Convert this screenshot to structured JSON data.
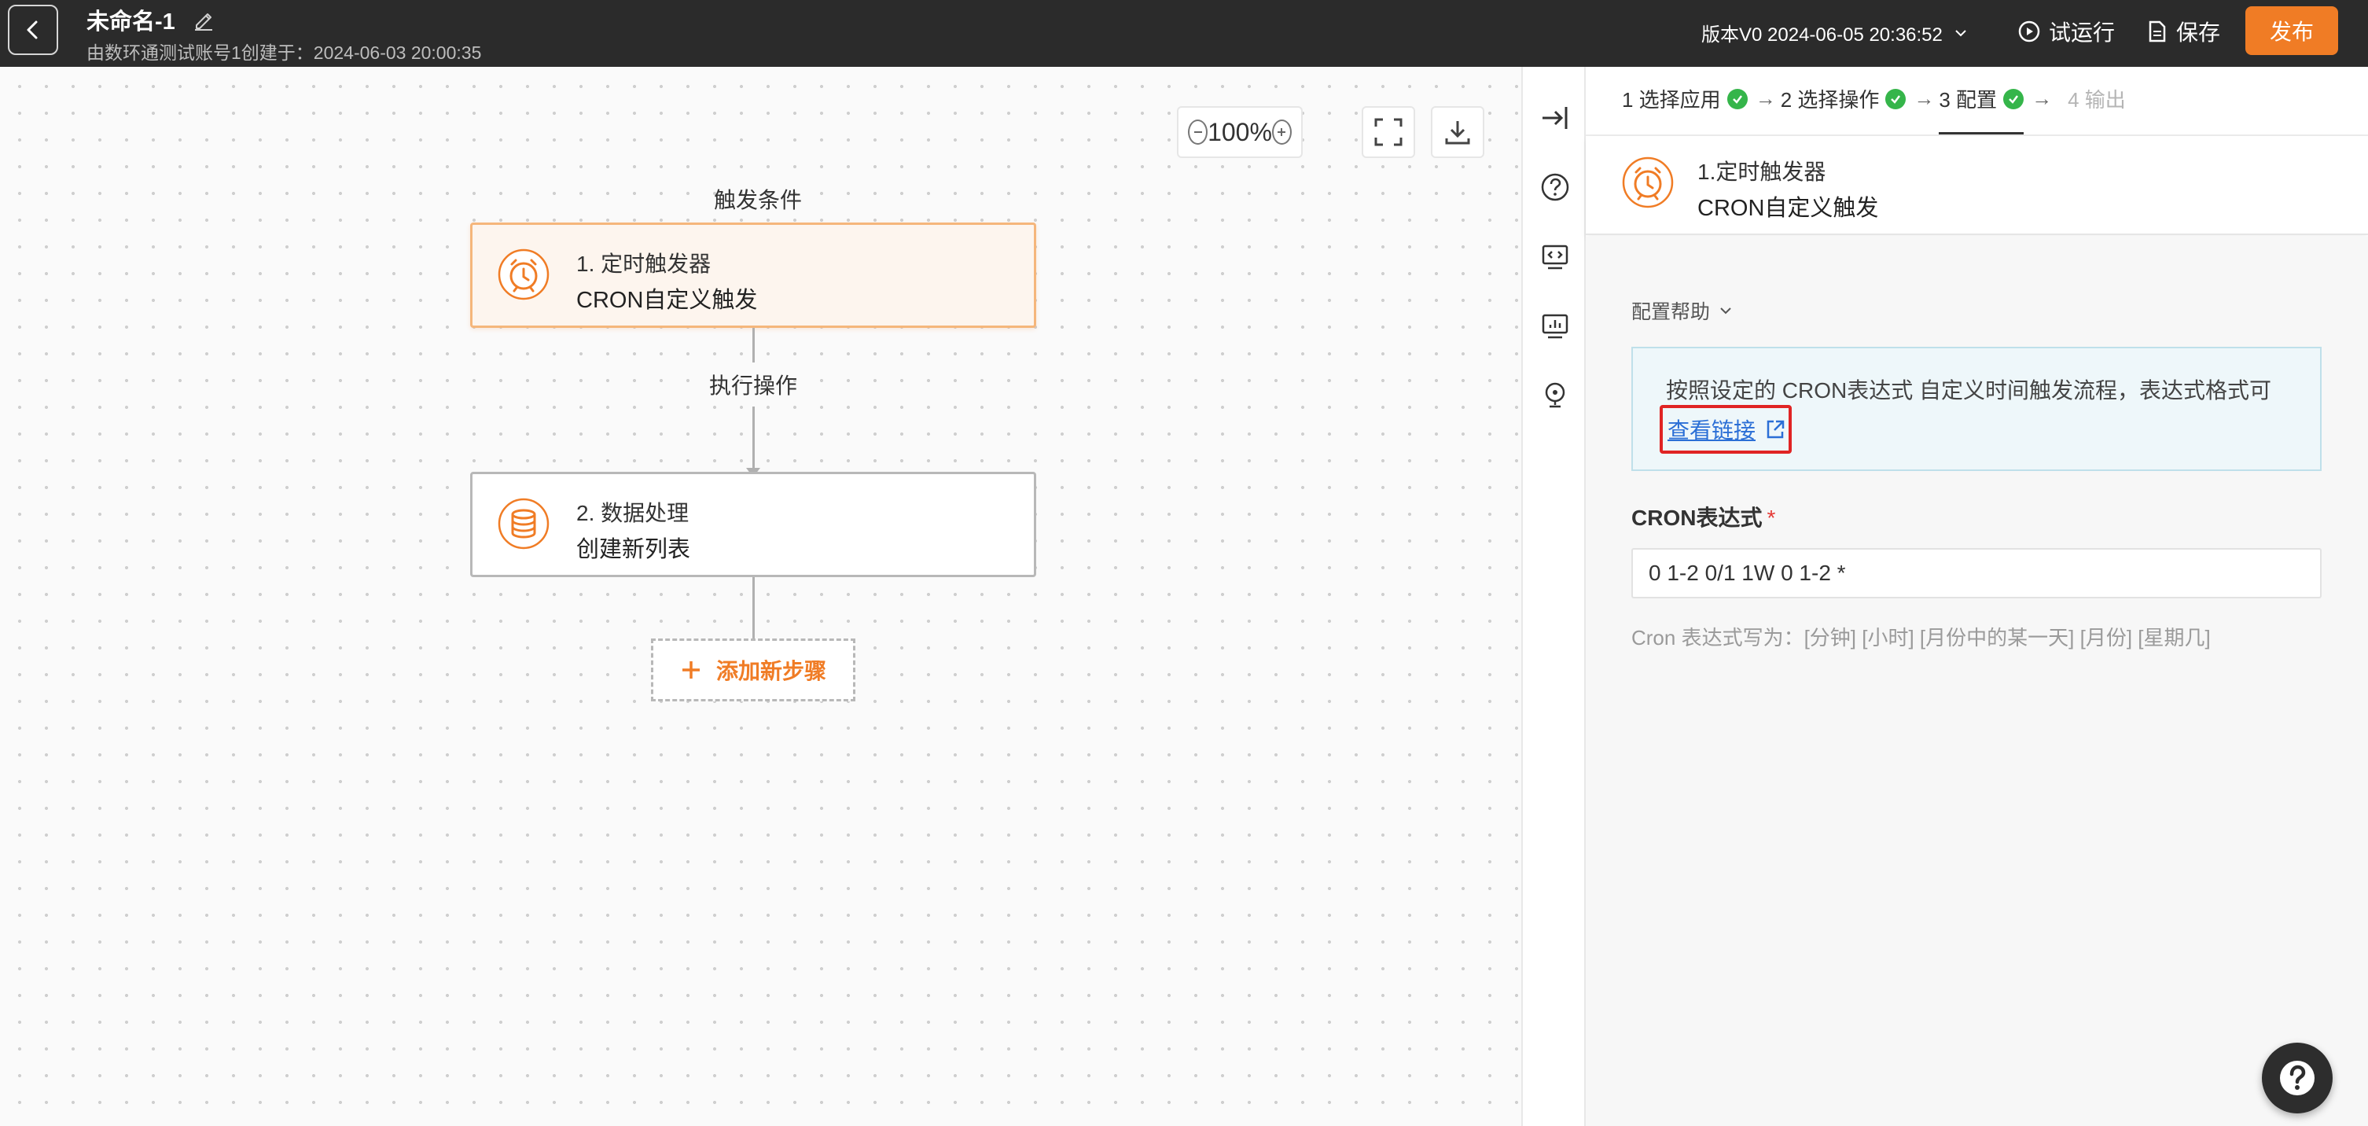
{
  "header": {
    "title": "未命名-1",
    "subtitle": "由数环通测试账号1创建于：2024-06-03 20:00:35",
    "version": "版本V0 2024-06-05 20:36:52",
    "test_run": "试运行",
    "save": "保存",
    "publish": "发布"
  },
  "colors": {
    "accent": "#f07c25",
    "topbar": "#2b2b2b",
    "success": "#35b54a",
    "highlight": "#e02424",
    "link": "#2b6fd6"
  },
  "canvas": {
    "zoom": "100%",
    "trigger_label": "触发条件",
    "action_label": "执行操作",
    "nodes": [
      {
        "title": "1. 定时触发器",
        "subtitle": "CRON自定义触发",
        "icon": "alarm-clock-icon"
      },
      {
        "title": "2. 数据处理",
        "subtitle": "创建新列表",
        "icon": "database-icon"
      }
    ],
    "add_step": "添加新步骤"
  },
  "side_icons": [
    "collapse-panel-icon",
    "help-icon",
    "code-icon",
    "monitor-icon",
    "lightbulb-icon"
  ],
  "panel": {
    "steps": [
      {
        "label": "1 选择应用",
        "done": true
      },
      {
        "label": "2 选择操作",
        "done": true
      },
      {
        "label": "3 配置",
        "done": true,
        "active": true
      },
      {
        "label": "4 输出",
        "done": false
      }
    ],
    "app_title": "1.定时触发器",
    "app_subtitle": "CRON自定义触发",
    "help_toggle": "配置帮助",
    "help_text": "按照设定的 CRON表达式 自定义时间触发流程，表达式格式可",
    "help_link": "查看链接",
    "cron_label": "CRON表达式",
    "cron_required": "*",
    "cron_value": "0 1-2 0/1 1W 0 1-2 *",
    "cron_hint": "Cron 表达式写为：[分钟] [小时] [月份中的某一天] [月份] [星期几]"
  }
}
